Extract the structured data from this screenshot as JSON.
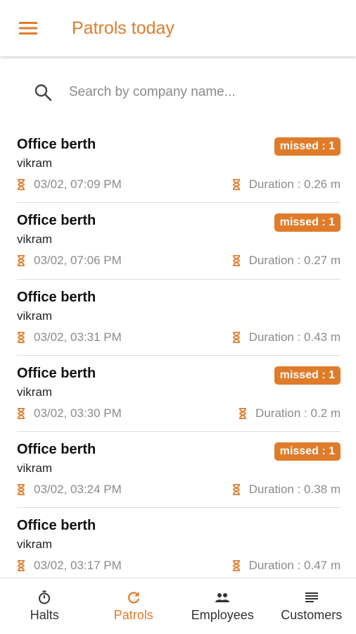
{
  "appbar": {
    "title": "Patrols today",
    "menu_icon": "hamburger-menu-icon"
  },
  "search": {
    "placeholder": "Search by company name..."
  },
  "colors": {
    "accent": "#e07b2a",
    "text": "#111111",
    "muted": "#8a8a8a",
    "divider": "#dcdcdc"
  },
  "patrols": [
    {
      "title": "Office berth",
      "user": "vikram",
      "time": "03/02, 07:09 PM",
      "duration": "Duration : 0.26 m",
      "badge": "missed : 1"
    },
    {
      "title": "Office berth",
      "user": "vikram",
      "time": "03/02, 07:06 PM",
      "duration": "Duration : 0.27 m",
      "badge": "missed : 1"
    },
    {
      "title": "Office berth",
      "user": "vikram",
      "time": "03/02, 03:31 PM",
      "duration": "Duration : 0.43 m",
      "badge": ""
    },
    {
      "title": "Office berth",
      "user": "vikram",
      "time": "03/02, 03:30 PM",
      "duration": "Duration : 0.2 m",
      "badge": "missed : 1"
    },
    {
      "title": "Office berth",
      "user": "vikram",
      "time": "03/02, 03:24 PM",
      "duration": "Duration : 0.38 m",
      "badge": "missed : 1"
    },
    {
      "title": "Office berth",
      "user": "vikram",
      "time": "03/02, 03:17 PM",
      "duration": "Duration : 0.47 m",
      "badge": ""
    }
  ],
  "nav": [
    {
      "label": "Halts",
      "icon": "stopwatch-icon",
      "active": false
    },
    {
      "label": "Patrols",
      "icon": "refresh-icon",
      "active": true
    },
    {
      "label": "Employees",
      "icon": "people-icon",
      "active": false
    },
    {
      "label": "Customers",
      "icon": "list-icon",
      "active": false
    }
  ]
}
